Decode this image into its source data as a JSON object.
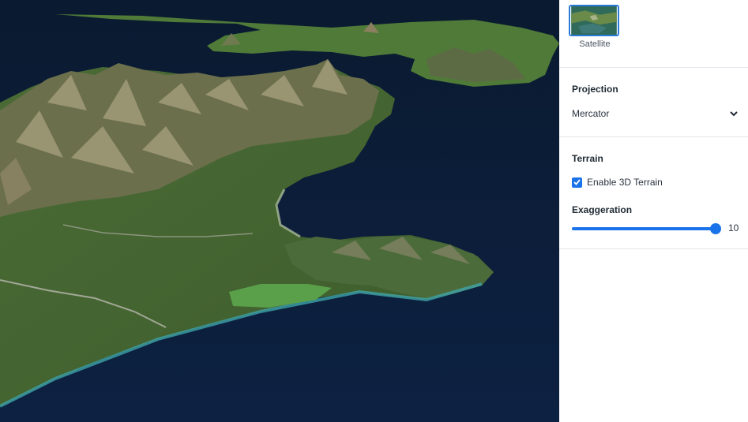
{
  "basemap": {
    "label": "Satellite",
    "icon": "satellite-thumbnail"
  },
  "projection": {
    "title": "Projection",
    "selected": "Mercator",
    "icon": "chevron-down-icon"
  },
  "terrain": {
    "title": "Terrain",
    "enable_label": "Enable 3D Terrain",
    "enabled": true,
    "exaggeration_label": "Exaggeration",
    "exaggeration_value": "10",
    "exaggeration_fraction": 1.0
  },
  "colors": {
    "accent": "#1a73e8",
    "ocean": "#0b1a33",
    "land": "#3f6a2e"
  }
}
